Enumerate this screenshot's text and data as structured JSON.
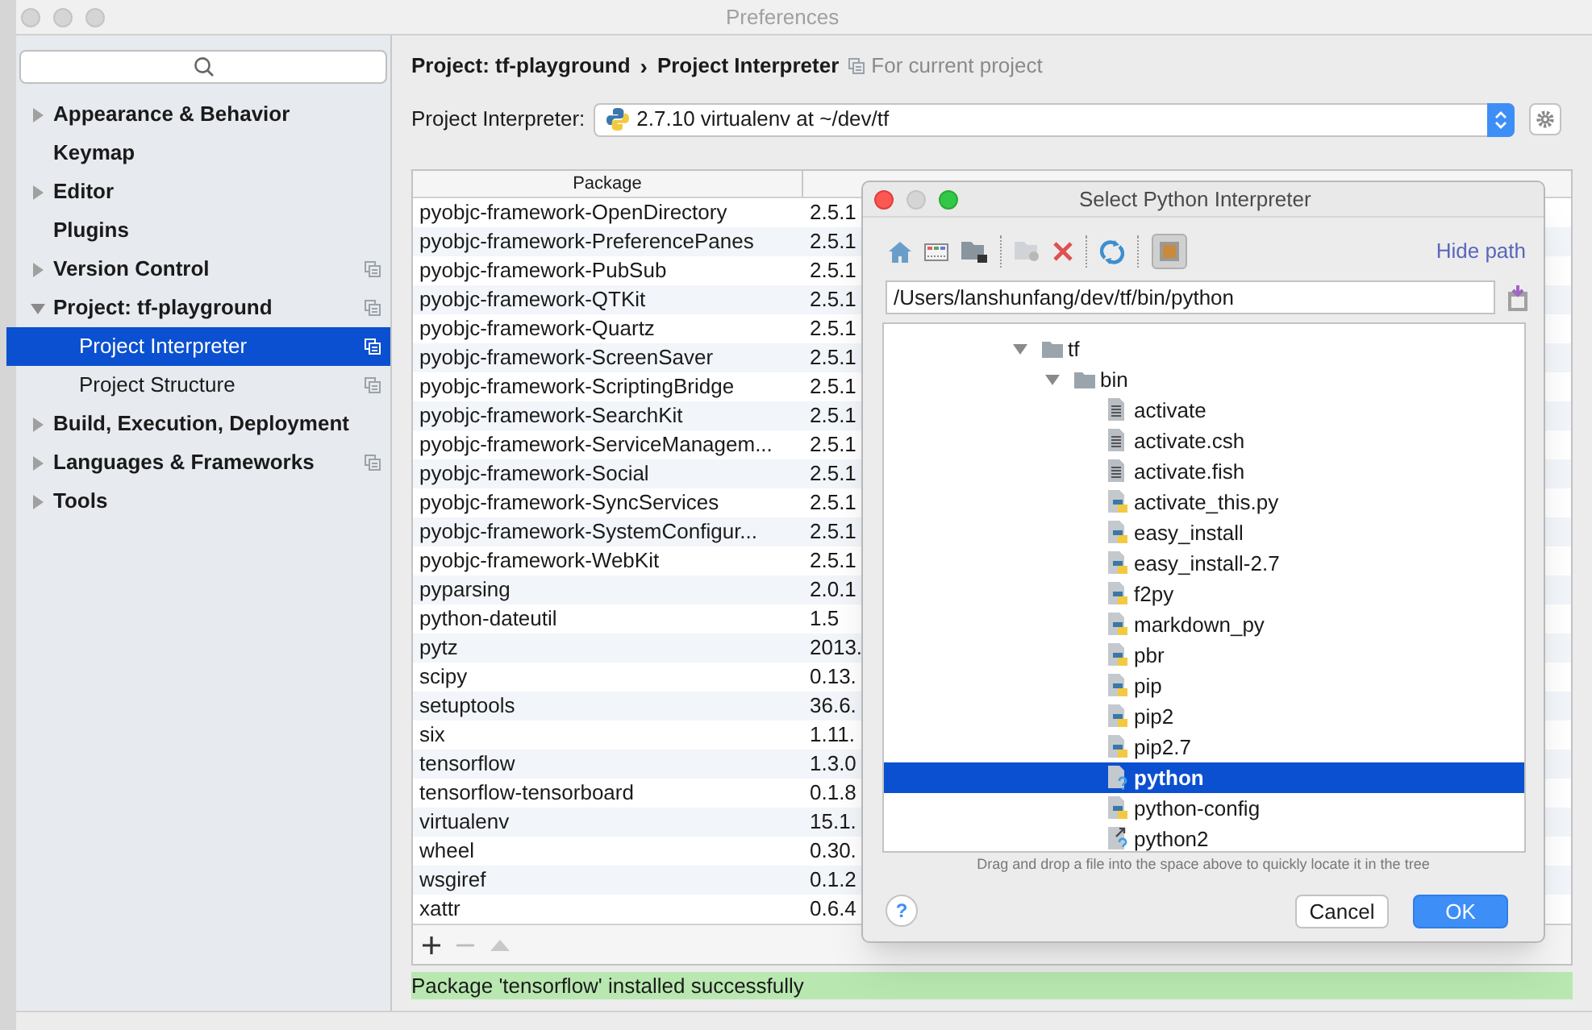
{
  "window": {
    "title": "Preferences"
  },
  "sidebar": {
    "items": [
      {
        "label": "Appearance & Behavior",
        "kind": "folder",
        "expanded": false,
        "project_level": false,
        "selected": false
      },
      {
        "label": "Keymap",
        "kind": "page",
        "project_level": false,
        "selected": false
      },
      {
        "label": "Editor",
        "kind": "folder",
        "expanded": false,
        "project_level": false,
        "selected": false
      },
      {
        "label": "Plugins",
        "kind": "page",
        "project_level": false,
        "selected": false
      },
      {
        "label": "Version Control",
        "kind": "folder",
        "expanded": false,
        "project_level": true,
        "selected": false
      },
      {
        "label": "Project: tf-playground",
        "kind": "folder",
        "expanded": true,
        "project_level": true,
        "selected": false,
        "children": [
          {
            "label": "Project Interpreter",
            "kind": "page",
            "project_level": true,
            "selected": true
          },
          {
            "label": "Project Structure",
            "kind": "page",
            "project_level": true,
            "selected": false
          }
        ]
      },
      {
        "label": "Build, Execution, Deployment",
        "kind": "folder",
        "expanded": false,
        "project_level": false,
        "selected": false
      },
      {
        "label": "Languages & Frameworks",
        "kind": "folder",
        "expanded": false,
        "project_level": true,
        "selected": false
      },
      {
        "label": "Tools",
        "kind": "folder",
        "expanded": false,
        "project_level": false,
        "selected": false
      }
    ]
  },
  "breadcrumb": {
    "path": [
      "Project: tf-playground",
      "Project Interpreter"
    ],
    "separator": "›",
    "scope": "For current project"
  },
  "interpreter": {
    "label": "Project Interpreter:",
    "value": "2.7.10 virtualenv at ~/dev/tf"
  },
  "packages": {
    "columns": [
      "Package"
    ],
    "rows": [
      {
        "name": "pyobjc-framework-OpenDirectory",
        "version": "2.5.1"
      },
      {
        "name": "pyobjc-framework-PreferencePanes",
        "version": "2.5.1"
      },
      {
        "name": "pyobjc-framework-PubSub",
        "version": "2.5.1"
      },
      {
        "name": "pyobjc-framework-QTKit",
        "version": "2.5.1"
      },
      {
        "name": "pyobjc-framework-Quartz",
        "version": "2.5.1"
      },
      {
        "name": "pyobjc-framework-ScreenSaver",
        "version": "2.5.1"
      },
      {
        "name": "pyobjc-framework-ScriptingBridge",
        "version": "2.5.1"
      },
      {
        "name": "pyobjc-framework-SearchKit",
        "version": "2.5.1"
      },
      {
        "name": "pyobjc-framework-ServiceManagem...",
        "version": "2.5.1"
      },
      {
        "name": "pyobjc-framework-Social",
        "version": "2.5.1"
      },
      {
        "name": "pyobjc-framework-SyncServices",
        "version": "2.5.1"
      },
      {
        "name": "pyobjc-framework-SystemConfigur...",
        "version": "2.5.1"
      },
      {
        "name": "pyobjc-framework-WebKit",
        "version": "2.5.1"
      },
      {
        "name": "pyparsing",
        "version": "2.0.1"
      },
      {
        "name": "python-dateutil",
        "version": "1.5"
      },
      {
        "name": "pytz",
        "version": "2013."
      },
      {
        "name": "scipy",
        "version": "0.13."
      },
      {
        "name": "setuptools",
        "version": "36.6."
      },
      {
        "name": "six",
        "version": "1.11."
      },
      {
        "name": "tensorflow",
        "version": "1.3.0"
      },
      {
        "name": "tensorflow-tensorboard",
        "version": "0.1.8"
      },
      {
        "name": "virtualenv",
        "version": "15.1."
      },
      {
        "name": "wheel",
        "version": "0.30."
      },
      {
        "name": "wsgiref",
        "version": "0.1.2"
      },
      {
        "name": "xattr",
        "version": "0.6.4"
      }
    ]
  },
  "status_message": "Package 'tensorflow' installed successfully",
  "dialog": {
    "title": "Select Python Interpreter",
    "hide_path": "Hide path",
    "path": "/Users/lanshunfang/dev/tf/bin/python",
    "tree": [
      {
        "label": "tf",
        "kind": "folder",
        "expanded": true,
        "selected": false,
        "children": [
          {
            "label": "bin",
            "kind": "folder",
            "expanded": true,
            "selected": false,
            "children": [
              {
                "label": "activate",
                "kind": "text",
                "selected": false
              },
              {
                "label": "activate.csh",
                "kind": "text",
                "selected": false
              },
              {
                "label": "activate.fish",
                "kind": "text",
                "selected": false
              },
              {
                "label": "activate_this.py",
                "kind": "python",
                "selected": false
              },
              {
                "label": "easy_install",
                "kind": "python",
                "selected": false
              },
              {
                "label": "easy_install-2.7",
                "kind": "python",
                "selected": false
              },
              {
                "label": "f2py",
                "kind": "python",
                "selected": false
              },
              {
                "label": "markdown_py",
                "kind": "python",
                "selected": false
              },
              {
                "label": "pbr",
                "kind": "python",
                "selected": false
              },
              {
                "label": "pip",
                "kind": "python",
                "selected": false
              },
              {
                "label": "pip2",
                "kind": "python",
                "selected": false
              },
              {
                "label": "pip2.7",
                "kind": "python",
                "selected": false
              },
              {
                "label": "python",
                "kind": "unknown",
                "selected": true
              },
              {
                "label": "python-config",
                "kind": "python",
                "selected": false
              },
              {
                "label": "python2",
                "kind": "link",
                "selected": false
              }
            ]
          }
        ]
      }
    ],
    "hint": "Drag and drop a file into the space above to quickly locate it in the tree",
    "help": "?",
    "buttons": [
      {
        "label": "Cancel",
        "default": false
      },
      {
        "label": "OK",
        "default": true
      }
    ]
  }
}
